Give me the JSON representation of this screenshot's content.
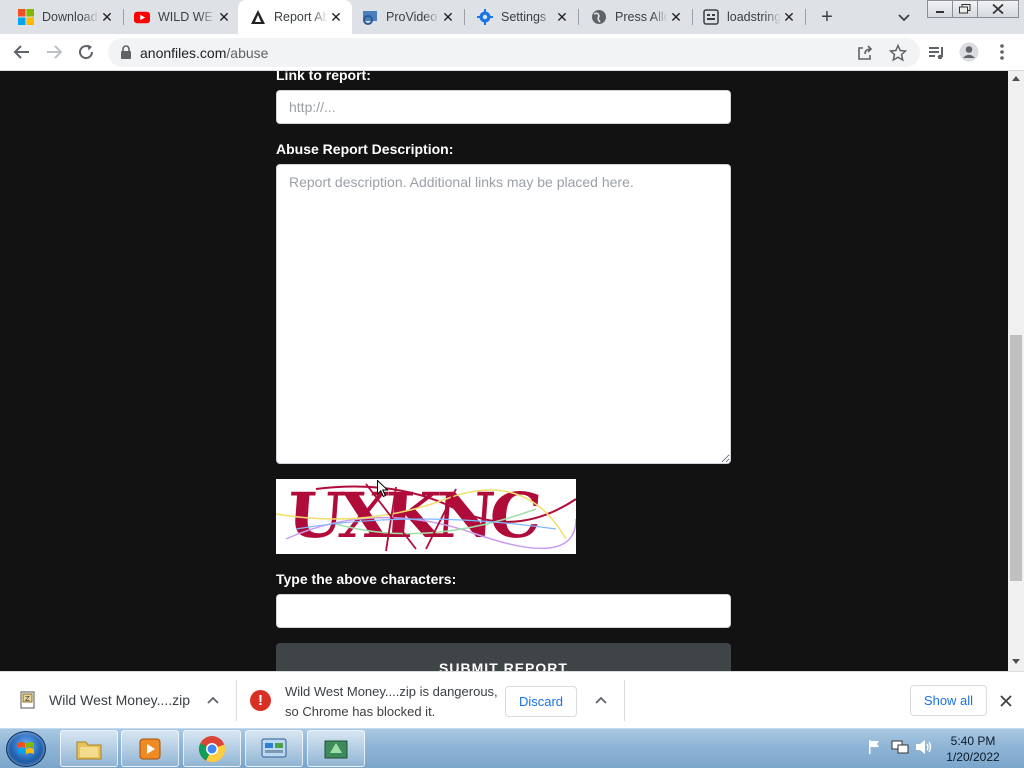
{
  "browser": {
    "tabs": [
      {
        "title": "Download",
        "icon": "windows-logo-icon",
        "active": false
      },
      {
        "title": "WILD WE",
        "icon": "youtube-icon",
        "active": false
      },
      {
        "title": "Report Abuse",
        "icon": "anonfiles-logo-icon",
        "active": true
      },
      {
        "title": "ProVideo",
        "icon": "provideo-icon",
        "active": false
      },
      {
        "title": "Settings",
        "icon": "gear-icon",
        "active": false
      },
      {
        "title": "Press Allo",
        "icon": "globe-icon",
        "active": false
      },
      {
        "title": "loadstring",
        "icon": "page-icon",
        "active": false
      }
    ],
    "url_host": "anonfiles.com",
    "url_path": "/abuse"
  },
  "form": {
    "link_label": "Link to report:",
    "link_placeholder": "http://...",
    "description_label": "Abuse Report Description:",
    "description_placeholder": "Report description. Additional links may be placed here.",
    "captcha_text": "UXKNC",
    "captcha_label": "Type the above characters:",
    "captcha_value": "",
    "submit_label": "SUBMIT REPORT"
  },
  "downloads": {
    "item1_name": "Wild West Money....zip",
    "item2_line1": "Wild West Money....zip is dangerous,",
    "item2_line2": "so Chrome has blocked it.",
    "discard_label": "Discard",
    "show_all_label": "Show all"
  },
  "taskbar": {
    "time": "5:40 PM",
    "date": "1/20/2022"
  },
  "colors": {
    "page_bg": "#121212",
    "captcha_red": "#b00c3a",
    "link_blue": "#1a73e8",
    "danger_red": "#d93025"
  }
}
